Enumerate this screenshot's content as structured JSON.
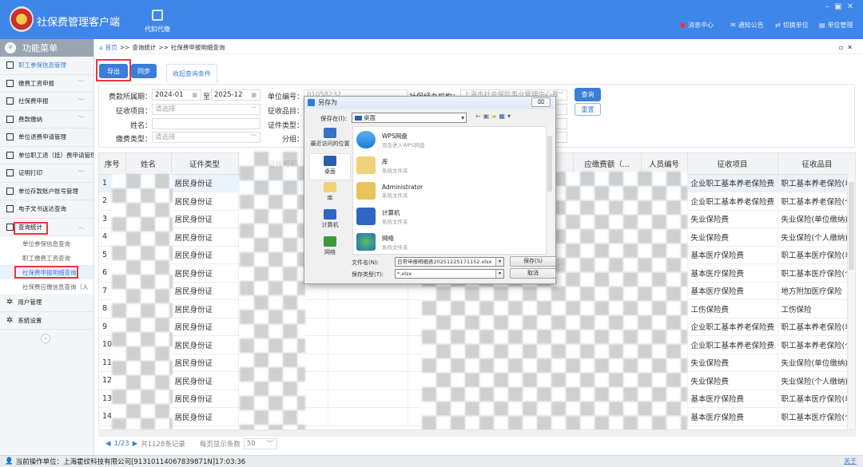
{
  "app": {
    "title": "社保费管理客户端",
    "module": "代扣代缴"
  },
  "topnav": [
    {
      "icon": "bell-icon",
      "label": "消息中心"
    },
    {
      "icon": "mail-icon",
      "label": "通知公告"
    },
    {
      "icon": "switch-icon",
      "label": "切换单位"
    },
    {
      "icon": "building-icon",
      "label": "单位管理"
    }
  ],
  "sidebar": {
    "title": "功能菜单",
    "items": [
      {
        "label": "职工参保信息管理",
        "active": true
      },
      {
        "label": "缴费工资申报",
        "chevron": true
      },
      {
        "label": "社保费申报",
        "chevron": true
      },
      {
        "label": "费款缴纳",
        "chevron": true
      },
      {
        "label": "单位退费申请管理"
      },
      {
        "label": "单位职工退（抵）费申请管理"
      },
      {
        "label": "证明打印",
        "chevron": true
      },
      {
        "label": "单位存款账户账号管理"
      },
      {
        "label": "电子文书送达查询"
      },
      {
        "label": "查询统计",
        "chevron": true
      }
    ],
    "sub": [
      "单位参保信息查询",
      "职工缴费工资查询",
      "社保费申报明细查询",
      "社保费应缴信息查询（人"
    ],
    "bottom": [
      "用户管理",
      "系统设置"
    ]
  },
  "breadcrumb": [
    "首页",
    ">>",
    "查询统计",
    ">>",
    "社保费申报明细查询"
  ],
  "toolbar": {
    "export": "导出",
    "sync": "同步",
    "collapse_tab": "收起查询条件"
  },
  "form": {
    "period_label": "费款所属期：",
    "period_from": "2024-01",
    "to": "至",
    "period_to": "2025-12",
    "item_label": "征收项目：",
    "item_ph": "请选择",
    "name_label": "姓名：",
    "paytype_label": "缴费类型：",
    "paytype_ph": "请选择",
    "unitno_label": "单位编号：",
    "unitno": "01058232",
    "subitem_label": "征收品目：",
    "idtype_label": "证件类型：",
    "group_label": "分组：",
    "agency_label": "社保经办机构：",
    "agency": "上海市社会保险事业管理中心嘉",
    "query": "查询",
    "reset": "重置"
  },
  "table": {
    "headers": [
      "序号",
      "姓名",
      "证件类型",
      "证件号码",
      "",
      "",
      "",
      "应缴费额（...",
      "人员编号",
      "征收项目",
      "征收品目"
    ],
    "rows": [
      {
        "no": "1",
        "idtype": "居民身份证",
        "item": "企业职工基本养老保险费",
        "sub": "职工基本养老保险(单位缴纳)"
      },
      {
        "no": "2",
        "idtype": "居民身份证",
        "item": "企业职工基本养老保险费",
        "sub": "职工基本养老保险(个人缴纳)"
      },
      {
        "no": "3",
        "idtype": "居民身份证",
        "item": "失业保险费",
        "sub": "失业保险(单位缴纳)"
      },
      {
        "no": "4",
        "idtype": "居民身份证",
        "item": "失业保险费",
        "sub": "失业保险(个人缴纳)"
      },
      {
        "no": "5",
        "idtype": "居民身份证",
        "item": "基本医疗保险费",
        "sub": "职工基本医疗保险(单位缴纳)"
      },
      {
        "no": "6",
        "idtype": "居民身份证",
        "item": "基本医疗保险费",
        "sub": "职工基本医疗保险(个人缴纳)"
      },
      {
        "no": "7",
        "idtype": "居民身份证",
        "item": "基本医疗保险费",
        "sub": "地方附加医疗保险"
      },
      {
        "no": "8",
        "idtype": "居民身份证",
        "item": "工伤保险费",
        "sub": "工伤保险"
      },
      {
        "no": "9",
        "idtype": "居民身份证",
        "item": "企业职工基本养老保险费",
        "sub": "职工基本养老保险(单位缴纳)"
      },
      {
        "no": "10",
        "idtype": "居民身份证",
        "item": "企业职工基本养老保险费",
        "sub": "职工基本养老保险(个人缴纳)"
      },
      {
        "no": "11",
        "idtype": "居民身份证",
        "item": "失业保险费",
        "sub": "失业保险(单位缴纳)"
      },
      {
        "no": "12",
        "idtype": "居民身份证",
        "item": "失业保险费",
        "sub": "失业保险(个人缴纳)"
      },
      {
        "no": "13",
        "idtype": "居民身份证",
        "item": "基本医疗保险费",
        "sub": "职工基本医疗保险(单位缴纳)"
      },
      {
        "no": "14",
        "idtype": "居民身份证",
        "item": "基本医疗保险费",
        "sub": "职工基本医疗保险(个人缴纳)"
      }
    ]
  },
  "pager": {
    "page": "1/23",
    "total": "共1128条记录",
    "per_page_label": "每页显示条数",
    "per_page": "50"
  },
  "status": {
    "text": "当前操作单位：上海霍纹科技有限公司[91310114067839871N]17:03:36",
    "about": "关于"
  },
  "dialog": {
    "title": "另存为",
    "save_in_label": "保存在(I):",
    "location": "桌面",
    "places": [
      "最近访问的位置",
      "桌面",
      "库",
      "计算机",
      "网络"
    ],
    "files": [
      {
        "name": "WPS网盘",
        "desc": "双击进入WPS网盘"
      },
      {
        "name": "库",
        "desc": "系统文件夹"
      },
      {
        "name": "Administrator",
        "desc": "系统文件夹"
      },
      {
        "name": "计算机",
        "desc": "系统文件夹"
      },
      {
        "name": "网络",
        "desc": "系统文件夹"
      }
    ],
    "filename_label": "文件名(N):",
    "filename": "日常申报明细表20251225171152.xlsx",
    "filetype_label": "保存类型(T):",
    "filetype": "*.xlsx",
    "save": "保存(S)",
    "cancel": "取消",
    "close": "⌧"
  }
}
